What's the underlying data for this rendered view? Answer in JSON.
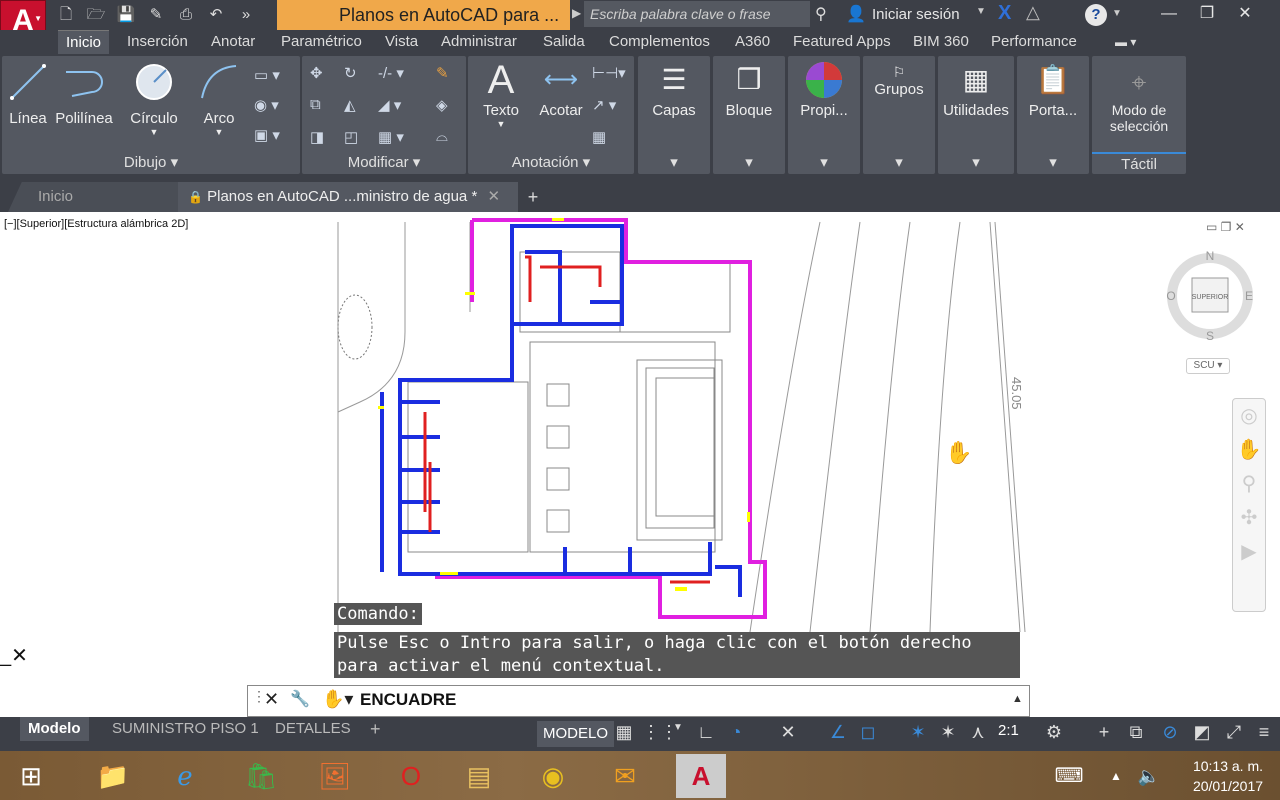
{
  "app": {
    "logo": "A",
    "qat_icons": [
      "new-icon",
      "open-icon",
      "save-icon",
      "saveas-icon",
      "print-icon",
      "undo-icon",
      "more-icon"
    ]
  },
  "title": {
    "document": "Planos en AutoCAD para ...",
    "search_placeholder": "Escriba palabra clave o frase",
    "signin": "Iniciar sesión"
  },
  "menu_tabs": [
    "Inicio",
    "Inserción",
    "Anotar",
    "Paramétrico",
    "Vista",
    "Administrar",
    "Salida",
    "Complementos",
    "A360",
    "Featured Apps",
    "BIM 360",
    "Performance"
  ],
  "ribbon": {
    "draw": {
      "title": "Dibujo",
      "tools": [
        "Línea",
        "Polilínea",
        "Círculo",
        "Arco"
      ]
    },
    "modify": {
      "title": "Modificar"
    },
    "annotation": {
      "title": "Anotación",
      "tools": [
        "Texto",
        "Acotar"
      ]
    },
    "large": [
      "Capas",
      "Bloque",
      "Propi...",
      "Grupos",
      "Utilidades",
      "Porta..."
    ],
    "touch": {
      "tool": "Modo de selección",
      "title": "Táctil"
    }
  },
  "file_tabs": {
    "home": "Inicio",
    "current": "Planos en AutoCAD ...ministro de agua *"
  },
  "viewport": {
    "label": "[−][Superior][Estructura alámbrica 2D]",
    "dimension_text": "45.05"
  },
  "viewcube": {
    "n": "N",
    "s": "S",
    "e": "E",
    "w": "O",
    "face": "SUPERIOR",
    "ucs": "SCU"
  },
  "command": {
    "label": "Comando:",
    "message": "Pulse Esc o Intro para salir, o haga clic con el botón derecho para activar el menú contextual.",
    "current": "ENCUADRE"
  },
  "layout_tabs": [
    "Modelo",
    "SUMINISTRO PISO 1",
    "DETALLES"
  ],
  "status": {
    "mode": "MODELO",
    "scale": "2:1"
  },
  "taskbar": {
    "time": "10:13 a. m.",
    "date": "20/01/2017"
  }
}
